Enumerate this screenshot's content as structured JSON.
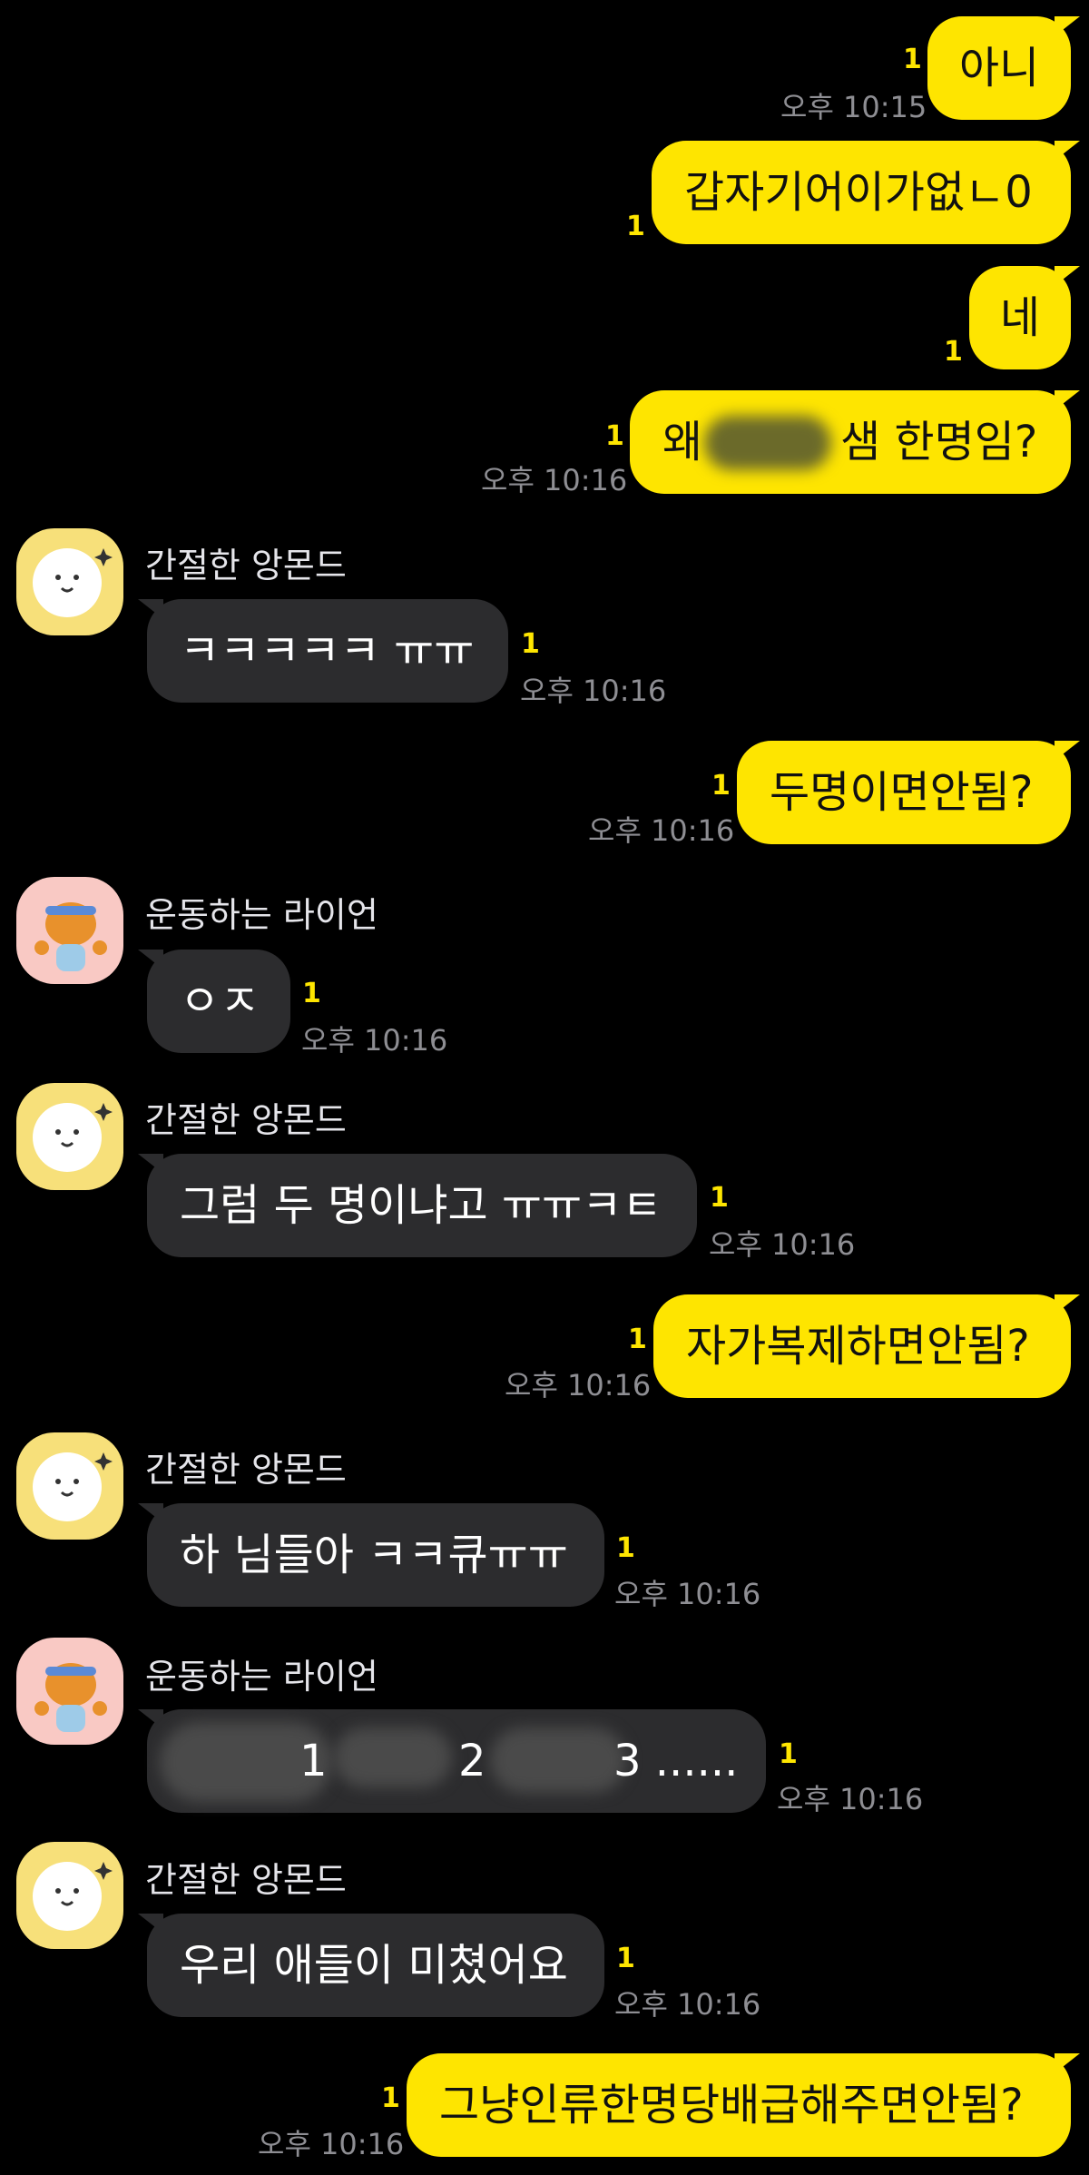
{
  "senders": {
    "almond": "간절한 앙몬드",
    "ryan": "운동하는 라이언"
  },
  "colors": {
    "background": "#000000",
    "my_bubble": "#FEE500",
    "other_bubble": "#2c2c2e",
    "unread": "#FEE500",
    "timestamp": "#8e8e93"
  },
  "messages": [
    {
      "text": "아니",
      "unread": "1",
      "time": "오후 10:15"
    },
    {
      "text": "갑자기어이가없ㄴ0",
      "unread": "1"
    },
    {
      "text": "네",
      "unread": "1"
    },
    {
      "text_start": "왜",
      "text_end": "샘 한명임?",
      "unread": "1",
      "time": "오후 10:16"
    },
    {
      "text": "ㅋㅋㅋㅋㅋ ㅠㅠ",
      "unread": "1",
      "time": "오후 10:16"
    },
    {
      "text": "두명이면안됨?",
      "unread": "1",
      "time": "오후 10:16"
    },
    {
      "text": "ㅇㅈ",
      "unread": "1",
      "time": "오후 10:16"
    },
    {
      "text": "그럼 두 명이냐고 ㅠㅠㅋㅌ",
      "unread": "1",
      "time": "오후 10:16"
    },
    {
      "text": "자가복제하면안됨?",
      "unread": "1",
      "time": "오후 10:16"
    },
    {
      "text": "하 님들아 ㅋㅋ큐ㅠㅠ",
      "unread": "1",
      "time": "오후 10:16"
    },
    {
      "text_a": "1",
      "text_b": "2",
      "text_c": "3 ......",
      "unread": "1",
      "time": "오후 10:16"
    },
    {
      "text": "우리 애들이 미쳤어요",
      "unread": "1",
      "time": "오후 10:16"
    },
    {
      "text": "그냥인류한명당배급해주면안됨?",
      "unread": "1",
      "time": "오후 10:16"
    }
  ]
}
